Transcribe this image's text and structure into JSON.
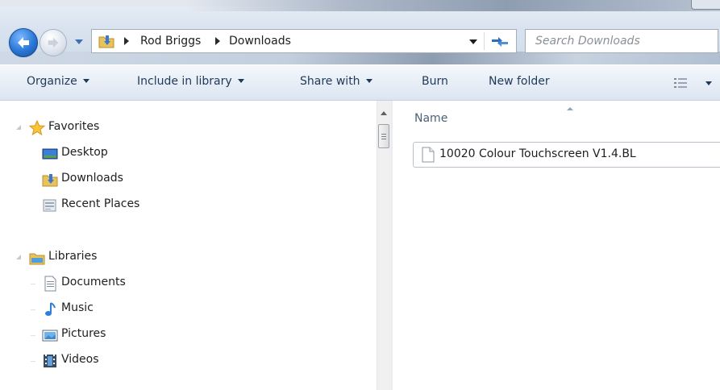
{
  "address": {
    "breadcrumbs": [
      "Rod Briggs",
      "Downloads"
    ],
    "search_placeholder": "Search Downloads"
  },
  "toolbar": {
    "organize": "Organize",
    "include_in_library": "Include in library",
    "share_with": "Share with",
    "burn": "Burn",
    "new_folder": "New folder"
  },
  "nav": {
    "favorites": {
      "label": "Favorites",
      "items": [
        {
          "label": "Desktop",
          "icon": "desktop-icon"
        },
        {
          "label": "Downloads",
          "icon": "downloads-folder-icon"
        },
        {
          "label": "Recent Places",
          "icon": "recent-places-icon"
        }
      ]
    },
    "libraries": {
      "label": "Libraries",
      "items": [
        {
          "label": "Documents",
          "icon": "documents-icon"
        },
        {
          "label": "Music",
          "icon": "music-icon"
        },
        {
          "label": "Pictures",
          "icon": "pictures-icon"
        },
        {
          "label": "Videos",
          "icon": "videos-icon"
        }
      ]
    }
  },
  "filelist": {
    "column_name": "Name",
    "files": [
      {
        "name": "10020 Colour Touchscreen V1.4.BL",
        "icon": "generic-file-icon"
      }
    ]
  },
  "colors": {
    "command_text": "#1e395b",
    "header_text": "#4c607a",
    "back_button": "#2a77d6"
  }
}
